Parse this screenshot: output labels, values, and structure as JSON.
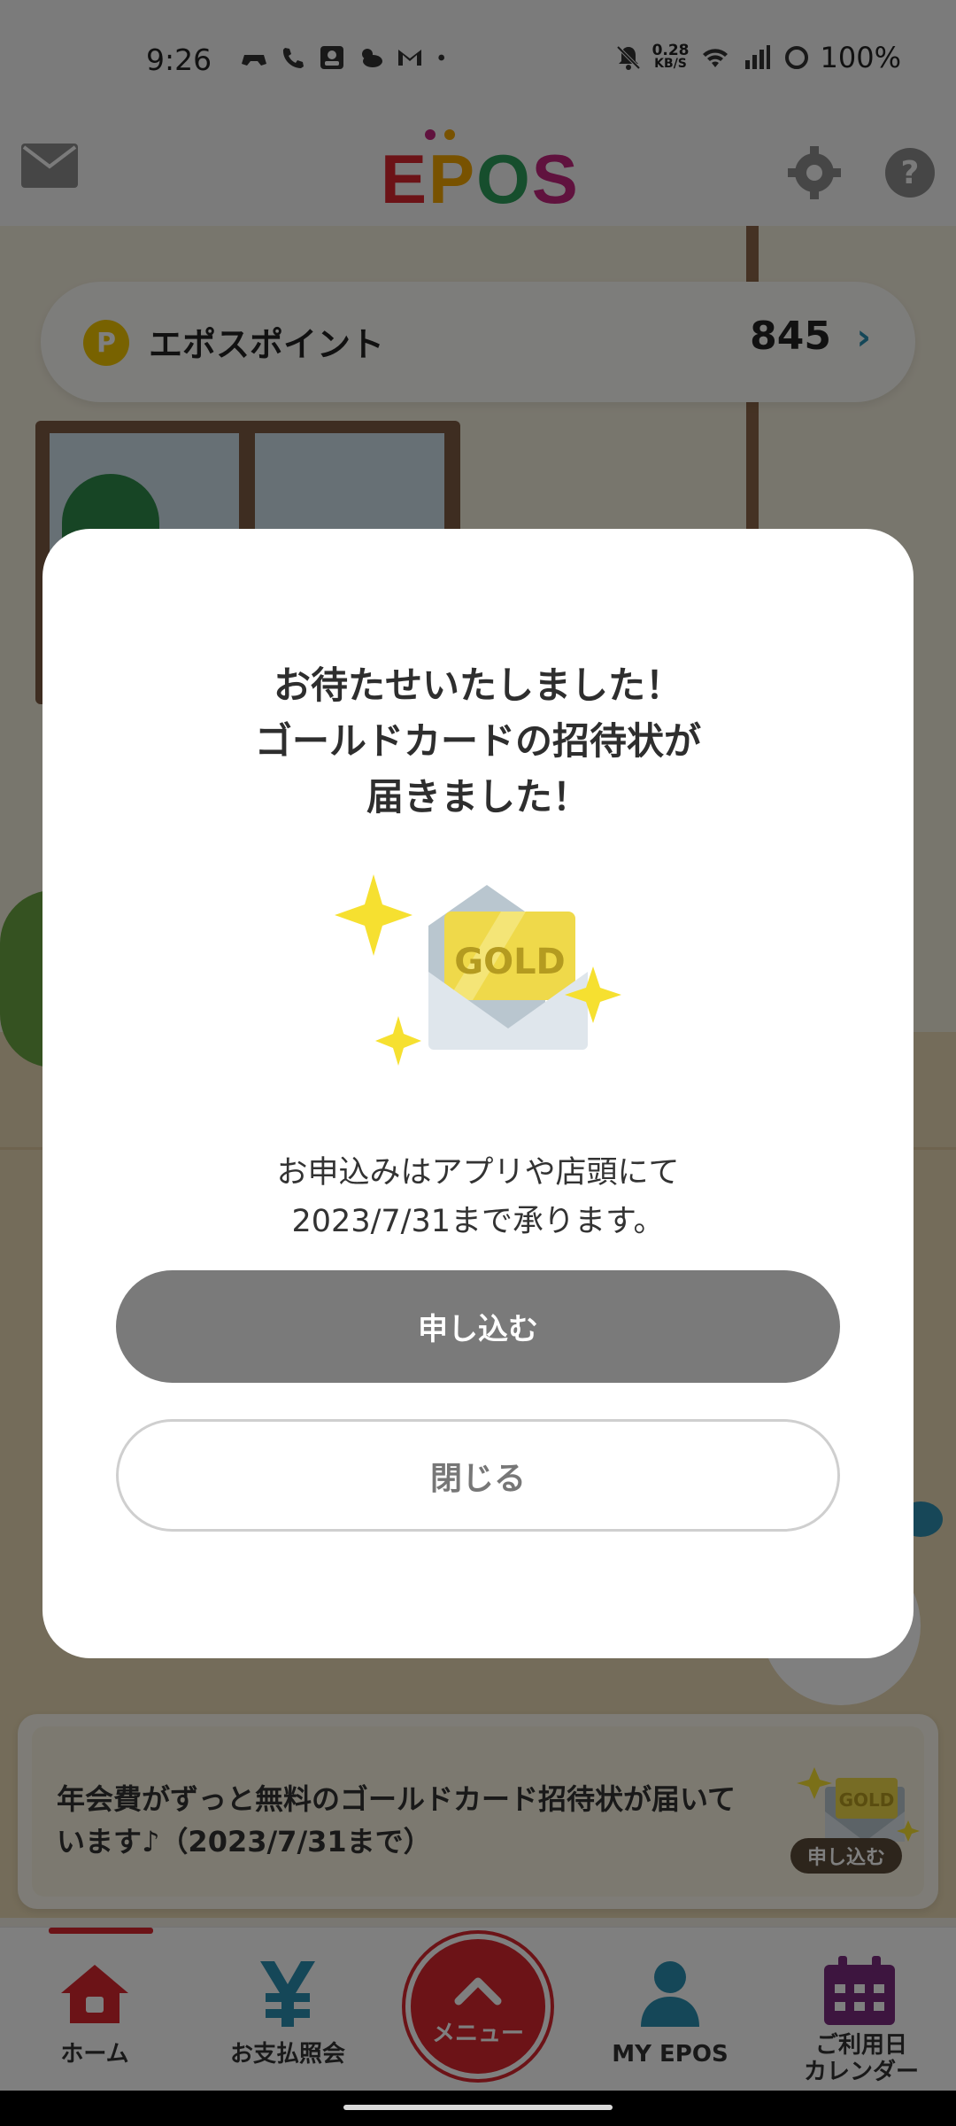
{
  "status_bar": {
    "time": "9:26",
    "net_speed_value": "0.28",
    "net_speed_unit": "KB/S",
    "battery": "100%"
  },
  "header": {
    "logo_letters": [
      "E",
      "P",
      "O",
      "S"
    ],
    "icons": [
      "mail-icon",
      "gear-icon",
      "help-icon"
    ]
  },
  "points": {
    "coin_letter": "P",
    "label": "エポスポイント",
    "value": "845",
    "chevron": "›"
  },
  "modal": {
    "title_line1": "お待たせいたしました！",
    "title_line2": "ゴールドカードの招待状が",
    "title_line3": "届きました！",
    "illustration_text": "GOLD",
    "body_line1": "お申込みはアプリや店頭にて",
    "body_line2": "2023/7/31まで承ります。",
    "apply_label": "申し込む",
    "close_label": "閉じる"
  },
  "banner": {
    "text_line1": "年会費がずっと無料のゴールドカード招待状が届いて",
    "text_line2": "います♪（2023/7/31まで）",
    "envelope_text": "GOLD",
    "button_label": "申し込む"
  },
  "bottom_nav": {
    "home": "ホーム",
    "payments": "お支払照会",
    "menu": "メニュー",
    "my_epos": "MY EPOS",
    "calendar_line1": "ご利用日",
    "calendar_line2": "カレンダー"
  },
  "colors": {
    "brand_red": "#d9262e",
    "accent_teal": "#2a8fb0",
    "gold": "#f1c400",
    "calendar_purple": "#7b2a7f"
  }
}
